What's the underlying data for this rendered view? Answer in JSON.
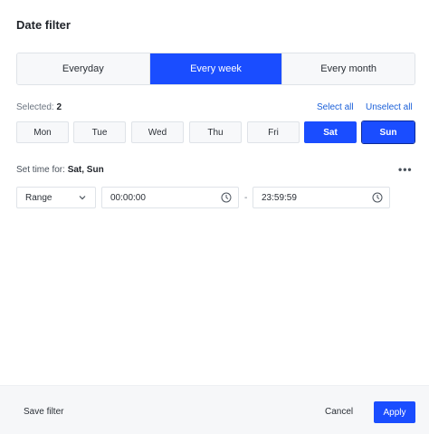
{
  "dialog": {
    "title": "Date filter"
  },
  "frequency": {
    "options": [
      "Everyday",
      "Every week",
      "Every month"
    ],
    "selected": "Every week"
  },
  "selection": {
    "label": "Selected:",
    "count": "2",
    "select_all": "Select all",
    "unselect_all": "Unselect all"
  },
  "days": [
    {
      "label": "Mon",
      "selected": false
    },
    {
      "label": "Tue",
      "selected": false
    },
    {
      "label": "Wed",
      "selected": false
    },
    {
      "label": "Thu",
      "selected": false
    },
    {
      "label": "Fri",
      "selected": false
    },
    {
      "label": "Sat",
      "selected": true
    },
    {
      "label": "Sun",
      "selected": true
    }
  ],
  "time": {
    "label": "Set time for:",
    "days": "Sat, Sun",
    "more_icon": "more-icon",
    "mode": "Range",
    "start": "00:00:00",
    "separator": "-",
    "end": "23:59:59",
    "clock_icon": "clock-icon"
  },
  "footer": {
    "save_filter": "Save filter",
    "cancel": "Cancel",
    "apply": "Apply"
  },
  "colors": {
    "accent": "#1a4dff",
    "link": "#1a5fd9",
    "footer_bg": "#f6f7f9"
  }
}
